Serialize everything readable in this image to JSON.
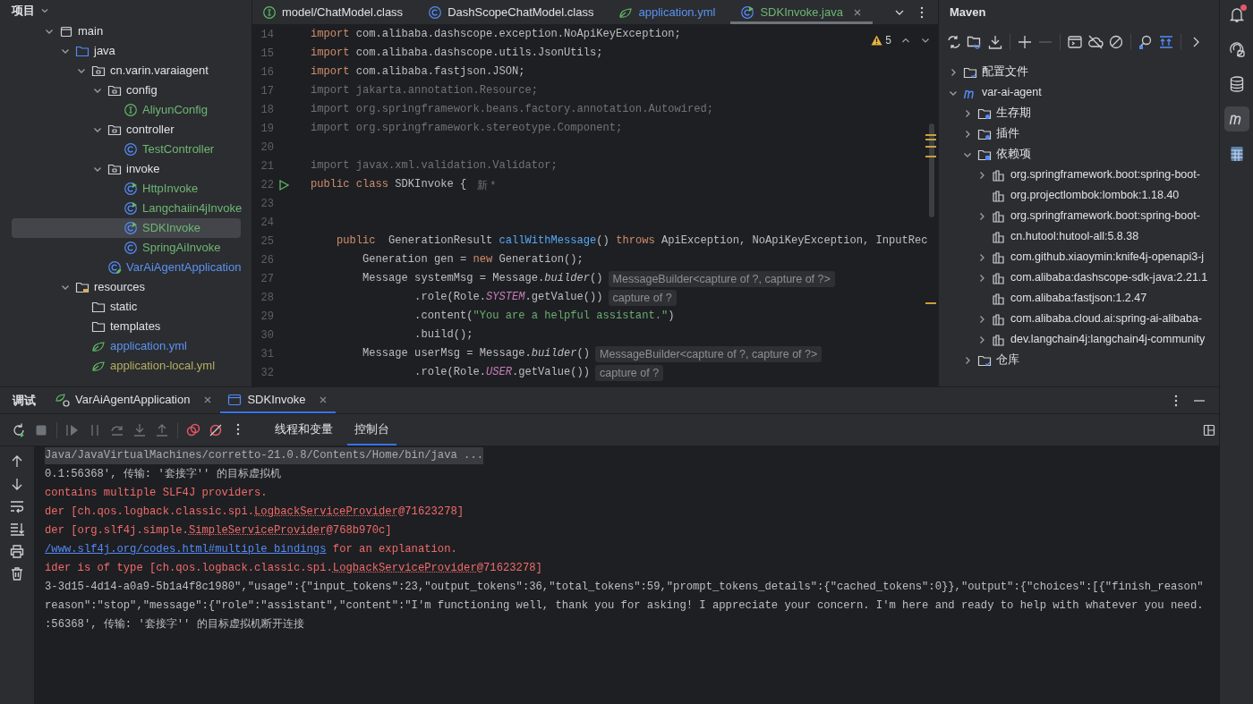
{
  "project_panel": {
    "title": "项目",
    "tree": [
      {
        "label": "main",
        "kind": "module",
        "expanded": true,
        "selected": false,
        "children": [
          {
            "label": "java",
            "kind": "source-folder",
            "expanded": true,
            "selected": false,
            "children": [
              {
                "label": "cn.varin.varaiagent",
                "kind": "package",
                "expanded": true,
                "selected": false,
                "children": [
                  {
                    "label": "config",
                    "kind": "package",
                    "expanded": true,
                    "selected": false,
                    "children": [
                      {
                        "label": "AliyunConfig",
                        "kind": "interface",
                        "color": "#6fb574",
                        "selected": false
                      }
                    ]
                  },
                  {
                    "label": "controller",
                    "kind": "package",
                    "expanded": true,
                    "selected": false,
                    "children": [
                      {
                        "label": "TestController",
                        "kind": "class",
                        "color": "#6fb574",
                        "selected": false
                      }
                    ]
                  },
                  {
                    "label": "invoke",
                    "kind": "package",
                    "expanded": true,
                    "selected": false,
                    "children": [
                      {
                        "label": "HttpInvoke",
                        "kind": "runnable-class",
                        "color": "#6fb574",
                        "selected": false
                      },
                      {
                        "label": "Langchaiin4jInvoke",
                        "kind": "runnable-class",
                        "color": "#6fb574",
                        "selected": false
                      },
                      {
                        "label": "SDKInvoke",
                        "kind": "runnable-class",
                        "color": "#6fb574",
                        "selected": true
                      },
                      {
                        "label": "SpringAiInvoke",
                        "kind": "class",
                        "color": "#6fb574",
                        "selected": false
                      }
                    ]
                  },
                  {
                    "label": "VarAiAgentApplication",
                    "kind": "spring-app",
                    "color": "#5c92f2",
                    "selected": false
                  }
                ]
              }
            ]
          },
          {
            "label": "resources",
            "kind": "resources",
            "expanded": true,
            "selected": false,
            "children": [
              {
                "label": "static",
                "kind": "folder",
                "selected": false
              },
              {
                "label": "templates",
                "kind": "folder",
                "selected": false
              },
              {
                "label": "application.yml",
                "kind": "yml",
                "color": "#5c92f2",
                "selected": false
              },
              {
                "label": "application-local.yml",
                "kind": "yml",
                "color": "#b3ae60",
                "selected": false
              }
            ]
          }
        ]
      }
    ]
  },
  "editor": {
    "tabs": [
      {
        "label": "model/ChatModel.class",
        "kind": "interface",
        "selected": false,
        "closable": false
      },
      {
        "label": "DashScopeChatModel.class",
        "kind": "class",
        "selected": false,
        "closable": false
      },
      {
        "label": "application.yml",
        "kind": "yml",
        "color": "#5c92f2",
        "selected": false,
        "closable": false
      },
      {
        "label": "SDKInvoke.java",
        "kind": "runnable-class",
        "color": "#6fb574",
        "selected": true,
        "closable": true
      }
    ],
    "inspection": {
      "warnings": "5"
    },
    "lines": [
      {
        "number": "14",
        "segments": [
          {
            "kind": "kw",
            "text": "import"
          },
          {
            "kind": "text",
            "text": " com.alibaba.dashscope.exception.NoApiKeyException;"
          }
        ]
      },
      {
        "number": "15",
        "segments": [
          {
            "kind": "kw",
            "text": "import"
          },
          {
            "kind": "text",
            "text": " com.alibaba.dashscope.utils.JsonUtils;"
          }
        ]
      },
      {
        "number": "16",
        "segments": [
          {
            "kind": "kw",
            "text": "import"
          },
          {
            "kind": "text",
            "text": " com.alibaba.fastjson.JSON;"
          }
        ]
      },
      {
        "number": "17",
        "segments": [
          {
            "kind": "unused",
            "text": "import jakarta.annotation.Resource;"
          }
        ]
      },
      {
        "number": "18",
        "segments": [
          {
            "kind": "unused",
            "text": "import org.springframework.beans.factory.annotation.Autowired;"
          }
        ]
      },
      {
        "number": "19",
        "segments": [
          {
            "kind": "unused",
            "text": "import org.springframework.stereotype.Component;"
          }
        ]
      },
      {
        "number": "20"
      },
      {
        "number": "21",
        "segments": [
          {
            "kind": "unused",
            "text": "import javax.xml.validation.Validator;"
          }
        ]
      },
      {
        "number": "22",
        "runnable": true,
        "segments": [
          {
            "kind": "kw",
            "text": "public class"
          },
          {
            "kind": "text",
            "text": " SDKInvoke {"
          },
          {
            "kind": "author",
            "text": "新 *"
          }
        ]
      },
      {
        "number": "23"
      },
      {
        "number": "24"
      },
      {
        "number": "25",
        "segments": [
          {
            "kind": "kw",
            "text": "    public"
          },
          {
            "kind": "text",
            "text": "  GenerationResult "
          },
          {
            "kind": "method",
            "text": "callWithMessage"
          },
          {
            "kind": "text",
            "text": "() "
          },
          {
            "kind": "kw",
            "text": "throws"
          },
          {
            "kind": "text",
            "text": " ApiException, NoApiKeyException, InputRec"
          }
        ]
      },
      {
        "number": "26",
        "segments": [
          {
            "kind": "text",
            "text": "        Generation gen = "
          },
          {
            "kind": "kw",
            "text": "new"
          },
          {
            "kind": "text",
            "text": " Generation();"
          }
        ]
      },
      {
        "number": "27",
        "segments": [
          {
            "kind": "text",
            "text": "        Message systemMsg = Message."
          },
          {
            "kind": "static-method",
            "text": "builder"
          },
          {
            "kind": "text",
            "text": "()"
          },
          {
            "kind": "hint",
            "text": "MessageBuilder<capture of ?, capture of ?>"
          }
        ]
      },
      {
        "number": "28",
        "segments": [
          {
            "kind": "text",
            "text": "                .role(Role."
          },
          {
            "kind": "constant",
            "text": "SYSTEM"
          },
          {
            "kind": "text",
            "text": ".getValue())"
          },
          {
            "kind": "hint",
            "text": "capture of ?"
          }
        ]
      },
      {
        "number": "29",
        "segments": [
          {
            "kind": "text",
            "text": "                .content("
          },
          {
            "kind": "string",
            "text": "\"You are a helpful assistant.\""
          },
          {
            "kind": "text",
            "text": ")"
          }
        ]
      },
      {
        "number": "30",
        "segments": [
          {
            "kind": "text",
            "text": "                .build();"
          }
        ]
      },
      {
        "number": "31",
        "segments": [
          {
            "kind": "text",
            "text": "        Message userMsg = Message."
          },
          {
            "kind": "static-method",
            "text": "builder"
          },
          {
            "kind": "text",
            "text": "()"
          },
          {
            "kind": "hint",
            "text": "MessageBuilder<capture of ?, capture of ?>"
          }
        ]
      },
      {
        "number": "32",
        "segments": [
          {
            "kind": "text",
            "text": "                .role(Role."
          },
          {
            "kind": "constant",
            "text": "USER"
          },
          {
            "kind": "text",
            "text": ".getValue())"
          },
          {
            "kind": "hint",
            "text": "capture of ?"
          }
        ]
      }
    ]
  },
  "maven": {
    "title": "Maven",
    "tree": [
      {
        "label": "配置文件",
        "kind": "profiles",
        "expanded": false,
        "selected": false
      },
      {
        "label": "var-ai-agent",
        "kind": "maven-module",
        "expanded": true,
        "selected": false,
        "children": [
          {
            "label": "生存期",
            "kind": "lifecycle",
            "expanded": false,
            "selected": false
          },
          {
            "label": "插件",
            "kind": "lifecycle",
            "expanded": false,
            "selected": false
          },
          {
            "label": "依赖项",
            "kind": "dependencies",
            "expanded": true,
            "selected": false,
            "children": [
              {
                "label": "org.springframework.boot:spring-boot-",
                "kind": "library",
                "expanded": false,
                "selected": false
              },
              {
                "label": "org.projectlombok:lombok:1.18.40",
                "kind": "library",
                "selected": false
              },
              {
                "label": "org.springframework.boot:spring-boot-",
                "kind": "library",
                "expanded": false,
                "selected": false
              },
              {
                "label": "cn.hutool:hutool-all:5.8.38",
                "kind": "library",
                "selected": false
              },
              {
                "label": "com.github.xiaoymin:knife4j-openapi3-j",
                "kind": "library",
                "expanded": false,
                "selected": false
              },
              {
                "label": "com.alibaba:dashscope-sdk-java:2.21.1",
                "kind": "library",
                "expanded": false,
                "selected": false
              },
              {
                "label": "com.alibaba:fastjson:1.2.47",
                "kind": "library",
                "selected": false
              },
              {
                "label": "com.alibaba.cloud.ai:spring-ai-alibaba-",
                "kind": "library",
                "expanded": false,
                "selected": false
              },
              {
                "label": "dev.langchain4j:langchain4j-community",
                "kind": "library",
                "expanded": false,
                "selected": false
              }
            ]
          },
          {
            "label": "仓库",
            "kind": "profiles",
            "expanded": false,
            "selected": false
          }
        ]
      }
    ]
  },
  "bottom_panel": {
    "title": "调试",
    "tabs": [
      {
        "label": "VarAiAgentApplication",
        "kind": "spring-app",
        "selected": false
      },
      {
        "label": "SDKInvoke",
        "kind": "run-config",
        "selected": true
      }
    ],
    "subtabs": [
      {
        "label": "线程和变量",
        "selected": false
      },
      {
        "label": "控制台",
        "selected": true
      }
    ],
    "console": [
      {
        "segments": [
          {
            "kind": "command",
            "text": "Java/JavaVirtualMachines/corretto-21.0.8/Contents/Home/bin/java ..."
          }
        ]
      },
      {
        "segments": [
          {
            "kind": "text",
            "text": "0.1:56368', 传输: '套接字'' 的目标虚拟机"
          }
        ]
      },
      {
        "segments": [
          {
            "kind": "error",
            "text": "contains multiple SLF4J providers."
          }
        ]
      },
      {
        "segments": [
          {
            "kind": "error",
            "text": "der [ch.qos.logback.classic.spi."
          },
          {
            "kind": "error-ref",
            "text": "LogbackServiceProvider"
          },
          {
            "kind": "error",
            "text": "@71623278]"
          }
        ]
      },
      {
        "segments": [
          {
            "kind": "error",
            "text": "der [org.slf4j.simple."
          },
          {
            "kind": "error-ref",
            "text": "SimpleServiceProvider"
          },
          {
            "kind": "error",
            "text": "@768b970c]"
          }
        ]
      },
      {
        "segments": [
          {
            "kind": "link",
            "text": "/www.slf4j.org/codes.html#multiple_bindings"
          },
          {
            "kind": "error",
            "text": " for an explanation."
          }
        ]
      },
      {
        "segments": [
          {
            "kind": "error",
            "text": "ider is of type [ch.qos.logback.classic.spi."
          },
          {
            "kind": "error-ref",
            "text": "LogbackServiceProvider"
          },
          {
            "kind": "error",
            "text": "@71623278]"
          }
        ]
      },
      {
        "segments": [
          {
            "kind": "text",
            "text": "3-3d15-4d14-a0a9-5b1a4f8c1980\",\"usage\":{\"input_tokens\":23,\"output_tokens\":36,\"total_tokens\":59,\"prompt_tokens_details\":{\"cached_tokens\":0}},\"output\":{\"choices\":[{\"finish_reason\""
          }
        ]
      },
      {
        "segments": [
          {
            "kind": "text",
            "text": "reason\":\"stop\",\"message\":{\"role\":\"assistant\",\"content\":\"I'm functioning well, thank you for asking! I appreciate your concern. I'm here and ready to help with whatever you need."
          }
        ]
      },
      {
        "segments": [
          {
            "kind": "text",
            "text": ":56368', 传输: '套接字'' 的目标虚拟机断开连接"
          }
        ]
      }
    ]
  },
  "right_toolbar": [
    {
      "kind": "notifications",
      "selected": false,
      "badge": true
    },
    {
      "kind": "ai",
      "selected": false,
      "badge": false
    },
    {
      "kind": "database",
      "selected": false,
      "badge": false
    },
    {
      "kind": "maven",
      "selected": true,
      "badge": false
    },
    {
      "kind": "grid",
      "selected": false,
      "badge": false
    }
  ]
}
